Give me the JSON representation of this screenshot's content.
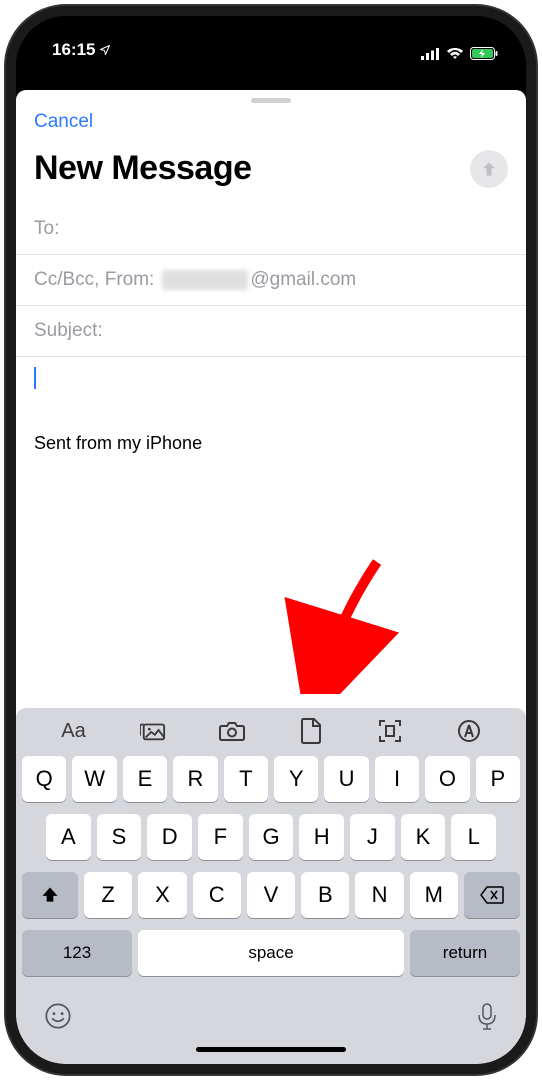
{
  "status": {
    "time": "16:15"
  },
  "header": {
    "cancel": "Cancel",
    "title": "New Message"
  },
  "fields": {
    "to_label": "To:",
    "ccbcc_label": "Cc/Bcc, From:",
    "from_domain": "@gmail.com",
    "subject_label": "Subject:"
  },
  "body": {
    "signature": "Sent from my iPhone"
  },
  "keyboard": {
    "row1": [
      "Q",
      "W",
      "E",
      "R",
      "T",
      "Y",
      "U",
      "I",
      "O",
      "P"
    ],
    "row2": [
      "A",
      "S",
      "D",
      "F",
      "G",
      "H",
      "J",
      "K",
      "L"
    ],
    "row3": [
      "Z",
      "X",
      "C",
      "V",
      "B",
      "N",
      "M"
    ],
    "numeric": "123",
    "space": "space",
    "return": "return"
  },
  "icons": {
    "format": "Aa"
  }
}
